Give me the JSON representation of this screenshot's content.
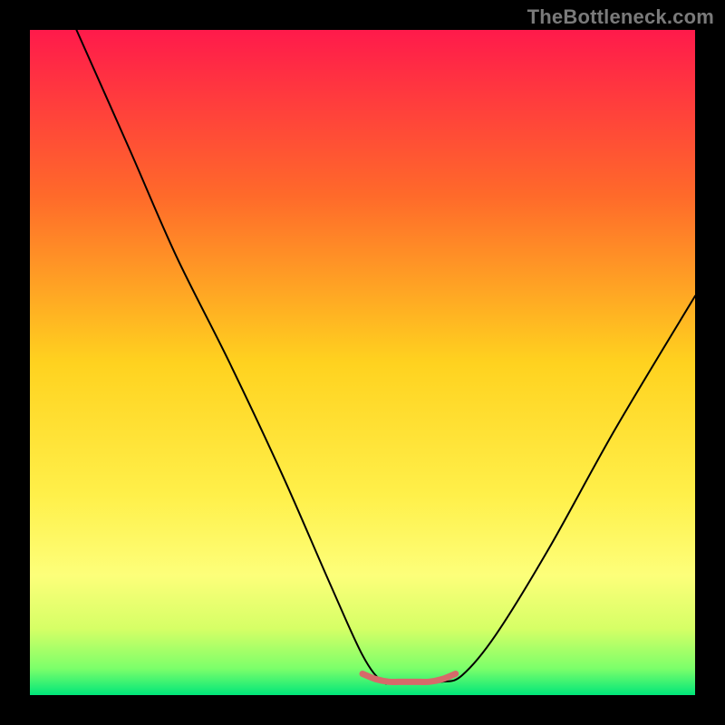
{
  "watermark": {
    "text": "TheBottleneck.com"
  },
  "chart_data": {
    "type": "line",
    "title": "",
    "xlabel": "",
    "ylabel": "",
    "xlim": [
      0,
      100
    ],
    "ylim": [
      0,
      100
    ],
    "grid": false,
    "legend": false,
    "background_gradient_stops": [
      {
        "offset": 0,
        "color": "#ff1a4b"
      },
      {
        "offset": 0.25,
        "color": "#ff6a2a"
      },
      {
        "offset": 0.5,
        "color": "#ffd21f"
      },
      {
        "offset": 0.7,
        "color": "#fff04a"
      },
      {
        "offset": 0.82,
        "color": "#fdff7a"
      },
      {
        "offset": 0.9,
        "color": "#d6ff66"
      },
      {
        "offset": 0.96,
        "color": "#7cff6a"
      },
      {
        "offset": 1.0,
        "color": "#00e67a"
      }
    ],
    "series": [
      {
        "name": "bottleneck-curve",
        "stroke": "#000000",
        "stroke_width": 2,
        "x": [
          7,
          15,
          22,
          30,
          38,
          45,
          50,
          53,
          55,
          58,
          62,
          65,
          70,
          78,
          88,
          100
        ],
        "values": [
          100,
          82,
          66,
          50,
          33,
          17,
          6,
          2,
          2,
          2,
          2,
          3,
          9,
          22,
          40,
          60
        ]
      },
      {
        "name": "optimal-zone-marker",
        "stroke": "#d66a6a",
        "stroke_width": 7,
        "x": [
          50,
          52,
          54,
          56,
          58,
          60,
          62,
          64
        ],
        "values": [
          3.2,
          2.4,
          2.0,
          2.0,
          2.0,
          2.0,
          2.4,
          3.2
        ]
      }
    ],
    "annotations": []
  }
}
